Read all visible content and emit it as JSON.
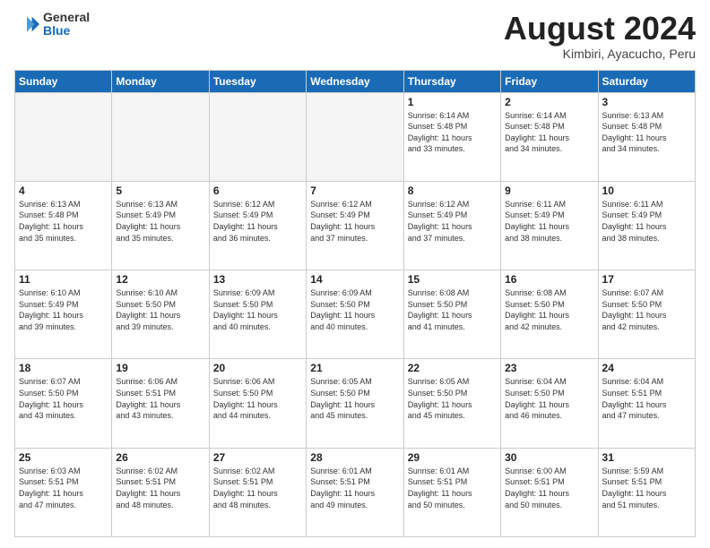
{
  "header": {
    "logo_general": "General",
    "logo_blue": "Blue",
    "month_title": "August 2024",
    "subtitle": "Kimbiri, Ayacucho, Peru"
  },
  "calendar": {
    "headers": [
      "Sunday",
      "Monday",
      "Tuesday",
      "Wednesday",
      "Thursday",
      "Friday",
      "Saturday"
    ],
    "rows": [
      [
        {
          "day": "",
          "info": "",
          "empty": true
        },
        {
          "day": "",
          "info": "",
          "empty": true
        },
        {
          "day": "",
          "info": "",
          "empty": true
        },
        {
          "day": "",
          "info": "",
          "empty": true
        },
        {
          "day": "1",
          "info": "Sunrise: 6:14 AM\nSunset: 5:48 PM\nDaylight: 11 hours\nand 33 minutes.",
          "empty": false
        },
        {
          "day": "2",
          "info": "Sunrise: 6:14 AM\nSunset: 5:48 PM\nDaylight: 11 hours\nand 34 minutes.",
          "empty": false
        },
        {
          "day": "3",
          "info": "Sunrise: 6:13 AM\nSunset: 5:48 PM\nDaylight: 11 hours\nand 34 minutes.",
          "empty": false
        }
      ],
      [
        {
          "day": "4",
          "info": "Sunrise: 6:13 AM\nSunset: 5:48 PM\nDaylight: 11 hours\nand 35 minutes.",
          "empty": false
        },
        {
          "day": "5",
          "info": "Sunrise: 6:13 AM\nSunset: 5:49 PM\nDaylight: 11 hours\nand 35 minutes.",
          "empty": false
        },
        {
          "day": "6",
          "info": "Sunrise: 6:12 AM\nSunset: 5:49 PM\nDaylight: 11 hours\nand 36 minutes.",
          "empty": false
        },
        {
          "day": "7",
          "info": "Sunrise: 6:12 AM\nSunset: 5:49 PM\nDaylight: 11 hours\nand 37 minutes.",
          "empty": false
        },
        {
          "day": "8",
          "info": "Sunrise: 6:12 AM\nSunset: 5:49 PM\nDaylight: 11 hours\nand 37 minutes.",
          "empty": false
        },
        {
          "day": "9",
          "info": "Sunrise: 6:11 AM\nSunset: 5:49 PM\nDaylight: 11 hours\nand 38 minutes.",
          "empty": false
        },
        {
          "day": "10",
          "info": "Sunrise: 6:11 AM\nSunset: 5:49 PM\nDaylight: 11 hours\nand 38 minutes.",
          "empty": false
        }
      ],
      [
        {
          "day": "11",
          "info": "Sunrise: 6:10 AM\nSunset: 5:49 PM\nDaylight: 11 hours\nand 39 minutes.",
          "empty": false
        },
        {
          "day": "12",
          "info": "Sunrise: 6:10 AM\nSunset: 5:50 PM\nDaylight: 11 hours\nand 39 minutes.",
          "empty": false
        },
        {
          "day": "13",
          "info": "Sunrise: 6:09 AM\nSunset: 5:50 PM\nDaylight: 11 hours\nand 40 minutes.",
          "empty": false
        },
        {
          "day": "14",
          "info": "Sunrise: 6:09 AM\nSunset: 5:50 PM\nDaylight: 11 hours\nand 40 minutes.",
          "empty": false
        },
        {
          "day": "15",
          "info": "Sunrise: 6:08 AM\nSunset: 5:50 PM\nDaylight: 11 hours\nand 41 minutes.",
          "empty": false
        },
        {
          "day": "16",
          "info": "Sunrise: 6:08 AM\nSunset: 5:50 PM\nDaylight: 11 hours\nand 42 minutes.",
          "empty": false
        },
        {
          "day": "17",
          "info": "Sunrise: 6:07 AM\nSunset: 5:50 PM\nDaylight: 11 hours\nand 42 minutes.",
          "empty": false
        }
      ],
      [
        {
          "day": "18",
          "info": "Sunrise: 6:07 AM\nSunset: 5:50 PM\nDaylight: 11 hours\nand 43 minutes.",
          "empty": false
        },
        {
          "day": "19",
          "info": "Sunrise: 6:06 AM\nSunset: 5:51 PM\nDaylight: 11 hours\nand 43 minutes.",
          "empty": false
        },
        {
          "day": "20",
          "info": "Sunrise: 6:06 AM\nSunset: 5:50 PM\nDaylight: 11 hours\nand 44 minutes.",
          "empty": false
        },
        {
          "day": "21",
          "info": "Sunrise: 6:05 AM\nSunset: 5:50 PM\nDaylight: 11 hours\nand 45 minutes.",
          "empty": false
        },
        {
          "day": "22",
          "info": "Sunrise: 6:05 AM\nSunset: 5:50 PM\nDaylight: 11 hours\nand 45 minutes.",
          "empty": false
        },
        {
          "day": "23",
          "info": "Sunrise: 6:04 AM\nSunset: 5:50 PM\nDaylight: 11 hours\nand 46 minutes.",
          "empty": false
        },
        {
          "day": "24",
          "info": "Sunrise: 6:04 AM\nSunset: 5:51 PM\nDaylight: 11 hours\nand 47 minutes.",
          "empty": false
        }
      ],
      [
        {
          "day": "25",
          "info": "Sunrise: 6:03 AM\nSunset: 5:51 PM\nDaylight: 11 hours\nand 47 minutes.",
          "empty": false
        },
        {
          "day": "26",
          "info": "Sunrise: 6:02 AM\nSunset: 5:51 PM\nDaylight: 11 hours\nand 48 minutes.",
          "empty": false
        },
        {
          "day": "27",
          "info": "Sunrise: 6:02 AM\nSunset: 5:51 PM\nDaylight: 11 hours\nand 48 minutes.",
          "empty": false
        },
        {
          "day": "28",
          "info": "Sunrise: 6:01 AM\nSunset: 5:51 PM\nDaylight: 11 hours\nand 49 minutes.",
          "empty": false
        },
        {
          "day": "29",
          "info": "Sunrise: 6:01 AM\nSunset: 5:51 PM\nDaylight: 11 hours\nand 50 minutes.",
          "empty": false
        },
        {
          "day": "30",
          "info": "Sunrise: 6:00 AM\nSunset: 5:51 PM\nDaylight: 11 hours\nand 50 minutes.",
          "empty": false
        },
        {
          "day": "31",
          "info": "Sunrise: 5:59 AM\nSunset: 5:51 PM\nDaylight: 11 hours\nand 51 minutes.",
          "empty": false
        }
      ]
    ]
  }
}
